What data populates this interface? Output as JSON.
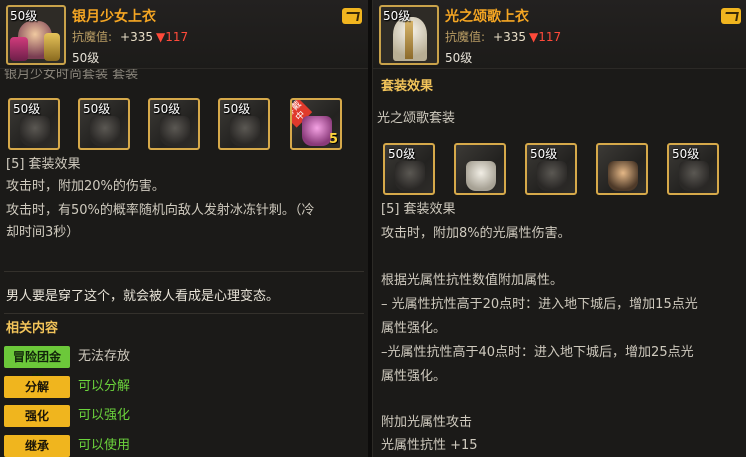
{
  "left": {
    "portrait_level": "50级",
    "item_name": "银月少女上衣",
    "stat_label": "抗魔值:",
    "stat_plus": "+335",
    "stat_drop": "▼117",
    "level": "50级",
    "set_name_partial": "银月少女时尚套装 套装",
    "slots": [
      {
        "level": "50级",
        "style": "dark"
      },
      {
        "level": "50级",
        "style": "dark"
      },
      {
        "level": "50级",
        "style": "dark"
      },
      {
        "level": "50级",
        "style": "dark"
      },
      {
        "level": "",
        "style": "pink",
        "wearing": "穿戴中",
        "count": "5"
      }
    ],
    "set_effect_header": "[5] 套装效果",
    "effect_lines": [
      "攻击时，附加20%的伤害。",
      "攻击时，有50%的概率随机向敌人发射冰冻针刺。（冷",
      "却时间3秒）"
    ],
    "flavor_text": "男人要是穿了这个，就会被人看成是心理变态。",
    "related_header": "相关内容",
    "actions": [
      {
        "tag": "冒险团金库",
        "text": "无法存放",
        "tag_color": "green",
        "text_color": "white"
      },
      {
        "tag": "分解",
        "text": "可以分解",
        "tag_color": "gold",
        "text_color": "green"
      },
      {
        "tag": "强化",
        "text": "可以强化",
        "tag_color": "gold",
        "text_color": "green"
      },
      {
        "tag": "继承",
        "text": "可以使用",
        "tag_color": "gold",
        "text_color": "green"
      }
    ]
  },
  "right": {
    "portrait_level": "50级",
    "item_name": "光之颂歌上衣",
    "stat_label": "抗魔值:",
    "stat_plus": "+335",
    "stat_drop": "▼117",
    "level": "50级",
    "set_effect_title": "套装效果",
    "set_name": "光之颂歌套装",
    "slots": [
      {
        "level": "50级",
        "style": "dark"
      },
      {
        "level": "",
        "style": "light"
      },
      {
        "level": "50级",
        "style": "dark"
      },
      {
        "level": "",
        "style": "figure"
      },
      {
        "level": "50级",
        "style": "dark"
      }
    ],
    "set_effect_header": "[5] 套装效果",
    "effect_lines": [
      "攻击时，附加8%的光属性伤害。",
      "",
      "根据光属性抗性数值附加属性。",
      "– 光属性抗性高于20点时：进入地下城后，增加15点光",
      "属性强化。",
      "–光属性抗性高于40点时：进入地下城后，增加25点光",
      "属性强化。",
      "",
      "附加光属性攻击",
      "光属性抗性 +15"
    ]
  },
  "colors": {
    "gold": "#f5a623",
    "green": "#6bd33c",
    "red": "#ff4a3a"
  }
}
